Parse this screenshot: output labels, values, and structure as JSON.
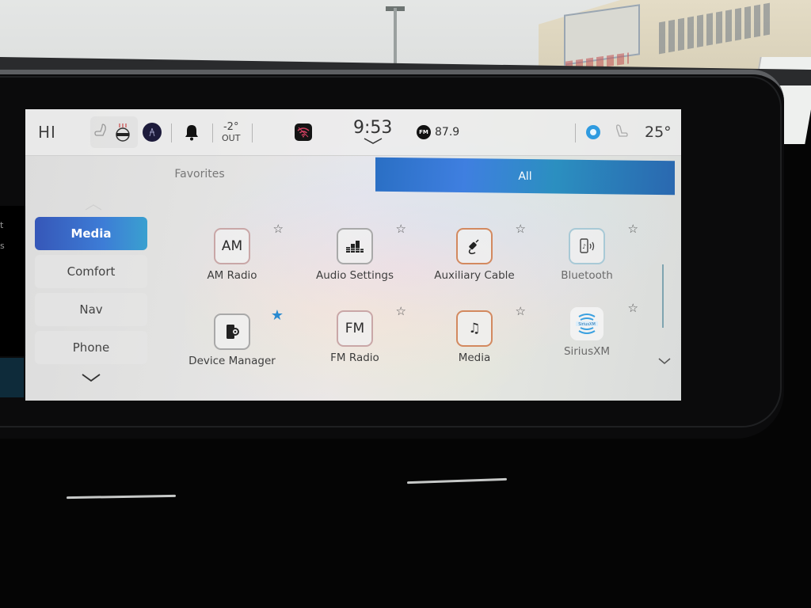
{
  "status_bar": {
    "greeting": "HI",
    "outside_temp": "-2°",
    "outside_label": "OUT",
    "time": "9:53",
    "radio_band": "FM",
    "radio_frequency": "87.9",
    "cabin_temp": "25°",
    "icons": [
      "seat-icon",
      "heated-seat-icon",
      "user-profile-icon",
      "bell-icon",
      "wifi-icon",
      "chevron-down-icon",
      "fm-badge-icon",
      "alexa-icon",
      "seat-icon"
    ]
  },
  "tabs": [
    {
      "label": "Favorites",
      "active": false
    },
    {
      "label": "All",
      "active": true
    }
  ],
  "categories": [
    {
      "label": "Media",
      "active": true
    },
    {
      "label": "Comfort",
      "active": false
    },
    {
      "label": "Nav",
      "active": false
    },
    {
      "label": "Phone",
      "active": false
    }
  ],
  "apps": [
    {
      "label": "AM Radio",
      "icon": "am-icon",
      "icon_text": "AM",
      "favorite": false
    },
    {
      "label": "Audio Settings",
      "icon": "equalizer-icon",
      "favorite": false
    },
    {
      "label": "Auxiliary Cable",
      "icon": "aux-cable-icon",
      "favorite": false
    },
    {
      "label": "Bluetooth",
      "icon": "bluetooth-phone-icon",
      "favorite": false
    },
    {
      "label": "Device Manager",
      "icon": "device-manager-icon",
      "favorite": true
    },
    {
      "label": "FM Radio",
      "icon": "fm-icon",
      "icon_text": "FM",
      "favorite": false
    },
    {
      "label": "Media",
      "icon": "music-note-icon",
      "favorite": false
    },
    {
      "label": "SiriusXM",
      "icon": "siriusxm-icon",
      "favorite": false
    }
  ],
  "glyphs": {
    "star_empty": "☆",
    "star_filled": "★",
    "music": "♫"
  },
  "colors": {
    "accent_blue": "#3d7cd6",
    "favorite_star": "#2a8ad0",
    "alexa_blue": "#2f9be0"
  },
  "side_text": [
    "t",
    "s"
  ]
}
